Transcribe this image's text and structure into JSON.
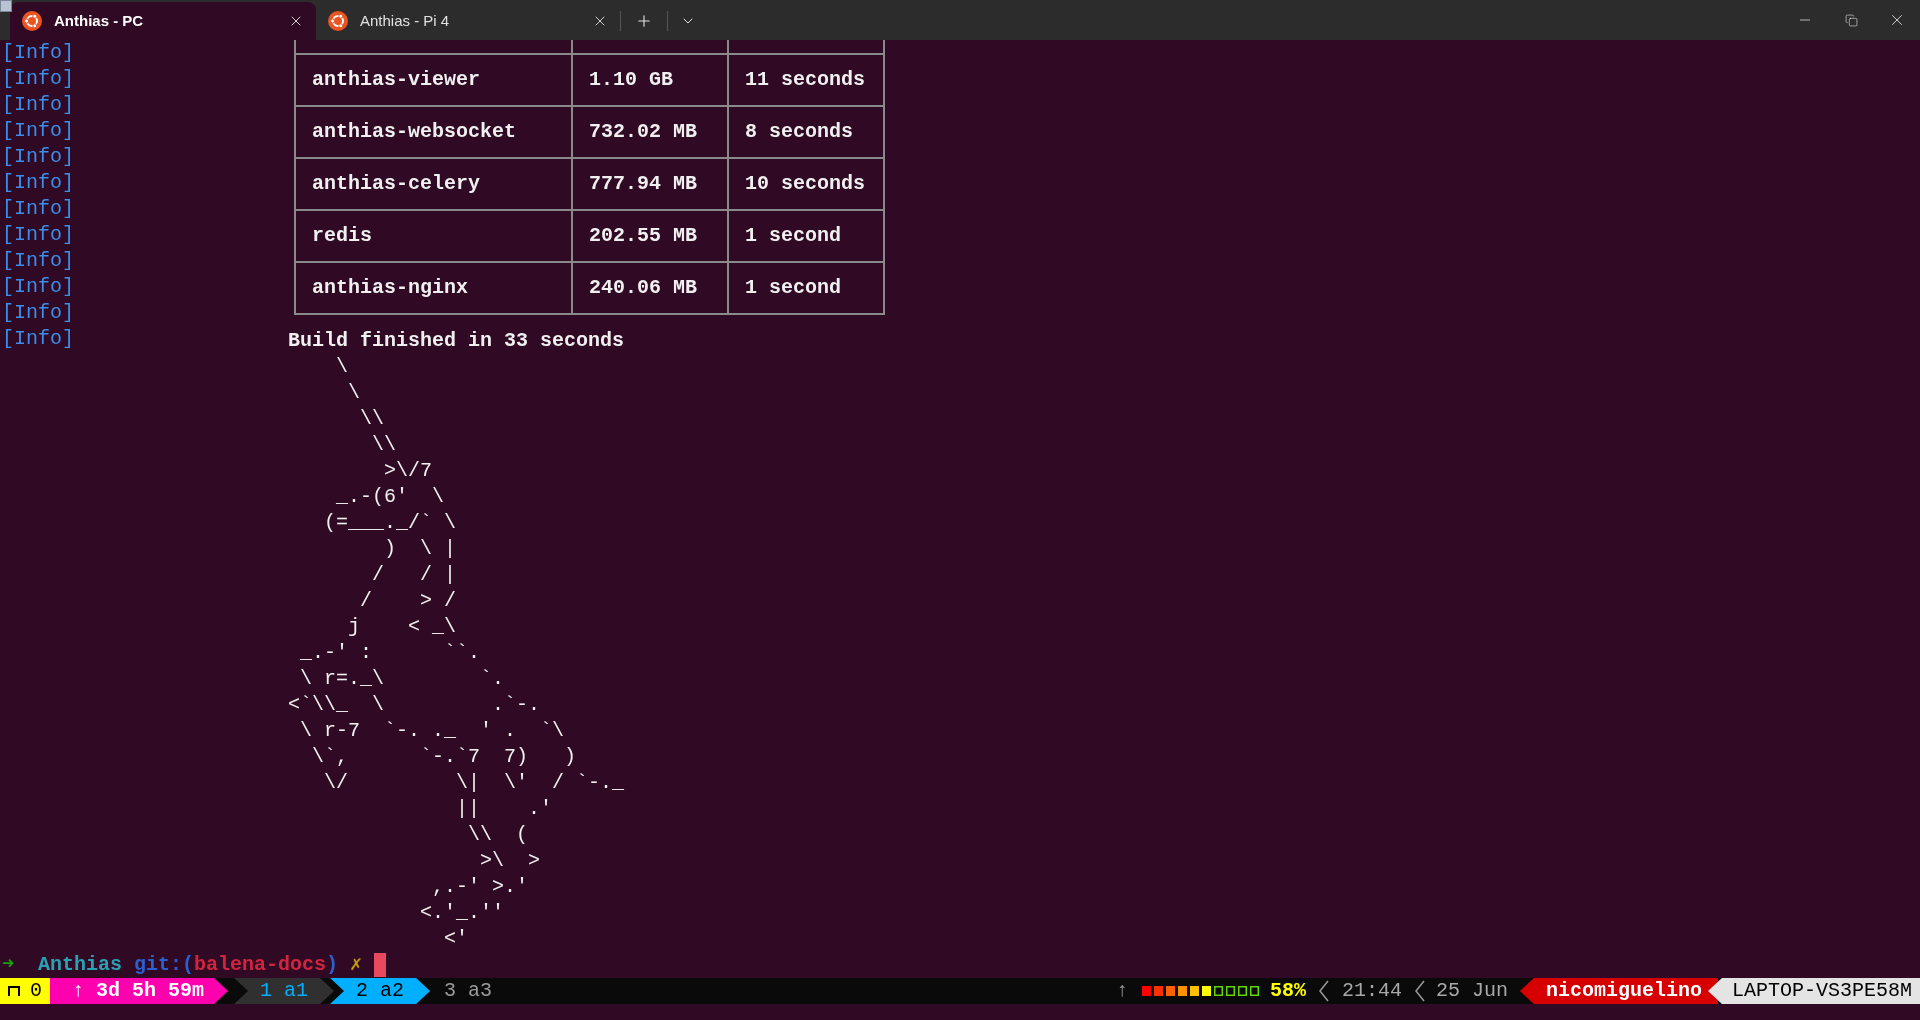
{
  "tabs": [
    {
      "title": "Anthias - PC",
      "selected": true
    },
    {
      "title": "Anthias - Pi 4",
      "selected": false
    }
  ],
  "log_lines": [
    "[Info]",
    "[Info]",
    "[Info]",
    "[Info]",
    "[Info]",
    "[Info]",
    "[Info]",
    "[Info]",
    "[Info]",
    "[Info]",
    "[Info]",
    "[Info]"
  ],
  "table": {
    "rows": [
      [
        "anthias-viewer",
        "1.10 GB",
        "11 seconds"
      ],
      [
        "anthias-websocket",
        "732.02 MB",
        "8 seconds"
      ],
      [
        "anthias-celery",
        "777.94 MB",
        "10 seconds"
      ],
      [
        "redis",
        "202.55 MB",
        "1 second"
      ],
      [
        "anthias-nginx",
        "240.06 MB",
        "1 second"
      ]
    ]
  },
  "build_message": "Build finished in 33 seconds",
  "ascii_art": [
    "    \\",
    "     \\",
    "      \\\\",
    "       \\\\",
    "        >\\/7",
    "    _.-(6'  \\",
    "   (=___._/` \\",
    "        )  \\ |",
    "       /   / |",
    "      /    > /",
    "     j    < _\\",
    " _.-' :      ``.",
    " \\ r=._\\        `.",
    "<`\\\\_  \\         .`-.",
    " \\ r-7  `-. ._  ' .  `\\",
    "  \\`,      `-.`7  7)   )",
    "   \\/         \\|  \\'  / `-._",
    "              ||    .'",
    "               \\\\  (",
    "                >\\  >",
    "            ,.-' >.'",
    "           <.'_.''",
    "             <'"
  ],
  "prompt": {
    "arrow": "➜",
    "directory": "Anthias",
    "git_open": "git:(",
    "branch": "balena-docs",
    "git_close": ")",
    "dirty_mark": "✗"
  },
  "status_bar": {
    "segments": [
      {
        "kind": "pane",
        "text": "0",
        "color": "#ffff00"
      },
      {
        "kind": "uptime",
        "text": "↑ 3d 5h 59m",
        "color": "#ff00af"
      }
    ],
    "windows": [
      {
        "label": "1 a1",
        "selected": false,
        "last": true
      },
      {
        "label": "2 a2",
        "selected": true,
        "last": false
      },
      {
        "label": "3 a3",
        "selected": false,
        "last": false
      }
    ],
    "arrow": "↑",
    "battery_percent": "58%",
    "time": "21:44",
    "date": "25 Jun",
    "user": {
      "text": "nicomiguelino",
      "color": "#d70000"
    },
    "host": {
      "text": "LAPTOP-VS3PE58M",
      "color": "#e4e4e4"
    }
  }
}
